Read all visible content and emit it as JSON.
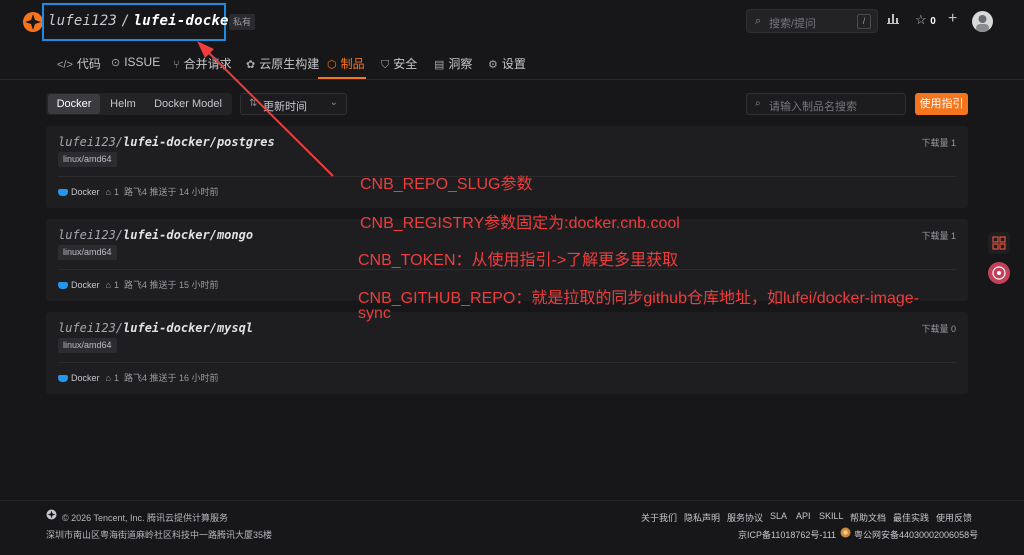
{
  "header": {
    "repo_owner": "lufei123",
    "repo_sep": "/",
    "repo_name": "lufei-docker",
    "private_label": "私有",
    "search_placeholder": "搜索/提问",
    "search_shortcut": "/",
    "star_count": "0",
    "plus": "+"
  },
  "tabs": [
    {
      "icon": "</>",
      "label": "代码"
    },
    {
      "icon": "⊙",
      "label": "ISSUE"
    },
    {
      "icon": "⑂",
      "label": "合并请求"
    },
    {
      "icon": "✿",
      "label": "云原生构建"
    },
    {
      "icon": "⬡",
      "label": "制品"
    },
    {
      "icon": "⛉",
      "label": "安全"
    },
    {
      "icon": "▤",
      "label": "洞察"
    },
    {
      "icon": "⚙",
      "label": "设置"
    }
  ],
  "filters": {
    "segments": [
      "Docker",
      "Helm",
      "Docker Model"
    ],
    "sort_label": "更新时间",
    "package_search_placeholder": "请输入制品名搜索",
    "guide_button": "使用指引"
  },
  "packages": [
    {
      "owner": "lufei123",
      "path": "lufei-docker/postgres",
      "platform": "linux/amd64",
      "downloads": "下载量 1",
      "type": "Docker",
      "tag_count": "1",
      "pushed": "路飞4 推送于 14 小时前"
    },
    {
      "owner": "lufei123",
      "path": "lufei-docker/mongo",
      "platform": "linux/amd64",
      "downloads": "下载量 1",
      "type": "Docker",
      "tag_count": "1",
      "pushed": "路飞4 推送于 15 小时前"
    },
    {
      "owner": "lufei123",
      "path": "lufei-docker/mysql",
      "platform": "linux/amd64",
      "downloads": "下载量 0",
      "type": "Docker",
      "tag_count": "1",
      "pushed": "路飞4 推送于 16 小时前"
    }
  ],
  "annotations": [
    "CNB_REPO_SLUG参数",
    "CNB_REGISTRY参数固定为:docker.cnb.cool",
    "CNB_TOKEN：从使用指引->了解更多里获取",
    "CNB_GITHUB_REPO：就是拉取的同步github仓库地址，如lufei/docker-image-",
    "sync"
  ],
  "footer": {
    "copyright": "© 2026 Tencent, Inc. 腾讯云提供计算服务",
    "address": "深圳市南山区粤海街道麻岭社区科技中一路腾讯大厦35楼",
    "links": [
      "关于我们",
      "隐私声明",
      "服务协议",
      "SLA",
      "API",
      "SKILL",
      "帮助文档",
      "最佳实践",
      "使用反馈"
    ],
    "icp": "京ICP备11018762号-111",
    "police": "粤公网安备44030002006058号"
  },
  "colors": {
    "accent": "#f5751f",
    "annotation": "#ee3d3d",
    "highlight_box": "#1e8be0",
    "docker_blue": "#2496ed"
  }
}
